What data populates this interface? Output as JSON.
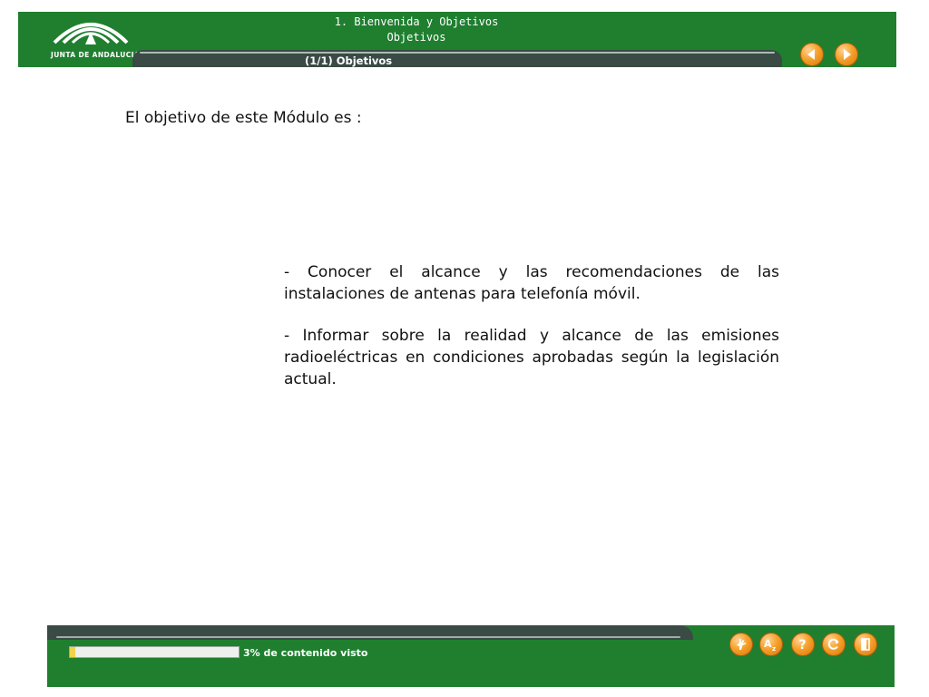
{
  "header": {
    "logo_text": "JUNTA DE ANDALUCIA",
    "section_title": "1. Bienvenida y Objetivos",
    "subsection_title": "Objetivos",
    "tab_label": "(1/1) Objetivos",
    "nav_prev_icon": "arrow-left-icon",
    "nav_next_icon": "arrow-right-icon"
  },
  "main": {
    "intro": "El objetivo de este Módulo es :",
    "objectives": [
      "- Conocer el alcance y las recomendaciones de las instalaciones de antenas para telefonía móvil.",
      "- Informar sobre la realidad y alcance de las emisiones radioeléctricas en condiciones aprobadas según la legislación actual."
    ]
  },
  "footer": {
    "progress_percent": 3,
    "progress_text": "3% de contenido visto",
    "tools": [
      {
        "name": "hand-icon"
      },
      {
        "name": "glossary-az-icon"
      },
      {
        "name": "help-icon"
      },
      {
        "name": "refresh-icon"
      },
      {
        "name": "exit-door-icon"
      }
    ]
  },
  "colors": {
    "header_green": "#1f7f2f",
    "band_dark": "#3a4a45",
    "button_orange": "#f5a22a",
    "progress_yellow": "#f2d34a"
  }
}
